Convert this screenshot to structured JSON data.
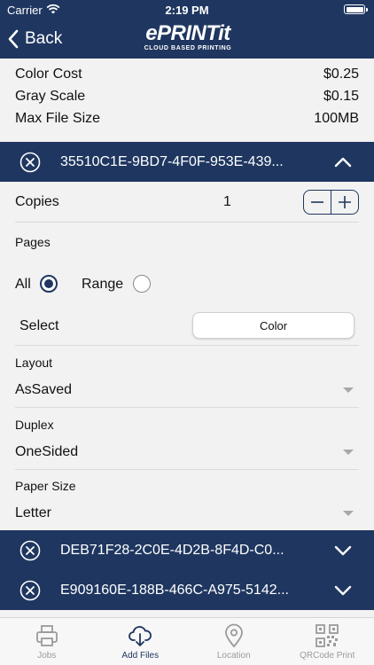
{
  "status_bar": {
    "carrier": "Carrier",
    "time": "2:19 PM"
  },
  "nav": {
    "back_label": "Back",
    "logo_text": "ePRINTit",
    "logo_tagline": "CLOUD BASED PRINTING"
  },
  "pricing": [
    {
      "label": "Color Cost",
      "value": "$0.25"
    },
    {
      "label": "Gray Scale",
      "value": "$0.15"
    },
    {
      "label": "Max File Size",
      "value": "100MB"
    }
  ],
  "expanded_file": {
    "name": "35510C1E-9BD7-4F0F-953E-439...",
    "copies_label": "Copies",
    "copies_value": "1",
    "pages_label": "Pages",
    "pages_options": [
      {
        "label": "All",
        "selected": true
      },
      {
        "label": "Range",
        "selected": false
      }
    ],
    "select_label": "Select",
    "color_mode": "Color",
    "layout_label": "Layout",
    "layout_value": "AsSaved",
    "duplex_label": "Duplex",
    "duplex_value": "OneSided",
    "paper_size_label": "Paper Size",
    "paper_size_value": "Letter"
  },
  "other_files": [
    {
      "name": "DEB71F28-2C0E-4D2B-8F4D-C0..."
    },
    {
      "name": "E909160E-188B-466C-A975-5142..."
    }
  ],
  "tabs": [
    {
      "label": "Jobs",
      "icon": "printer-icon",
      "active": false
    },
    {
      "label": "Add Files",
      "icon": "cloud-download-icon",
      "active": true
    },
    {
      "label": "Location",
      "icon": "location-pin-icon",
      "active": false
    },
    {
      "label": "QRCode Print",
      "icon": "qr-code-icon",
      "active": false
    }
  ],
  "colors": {
    "brand": "#1f3760",
    "background": "#f2f2f2",
    "tab_inactive": "#9a9a9a"
  }
}
